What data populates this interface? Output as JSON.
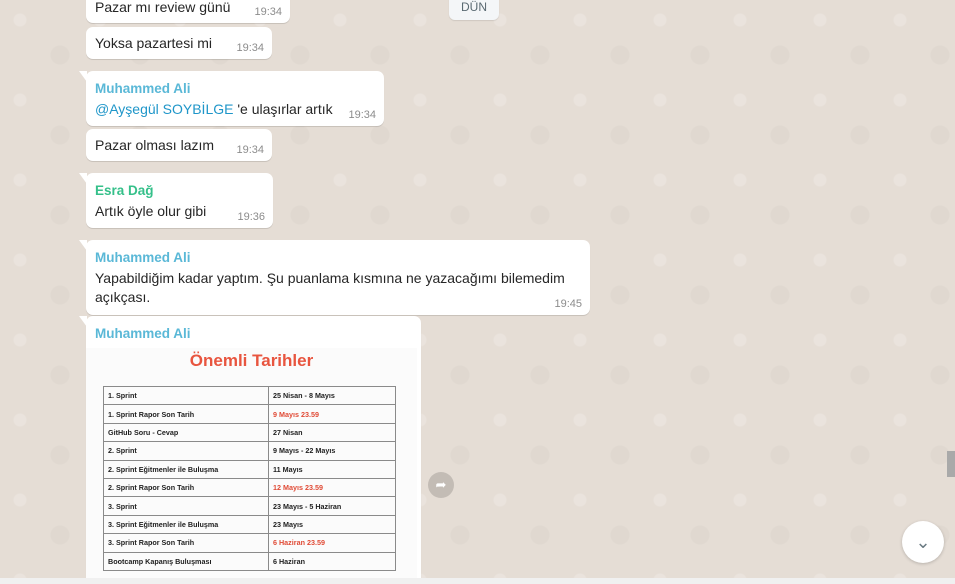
{
  "date_separator": "DÜN",
  "messages": [
    {
      "text": "Pazar mı review günü",
      "time": "19:34"
    },
    {
      "text": "Yoksa pazartesi mi",
      "time": "19:34"
    },
    {
      "sender": "Muhammed Ali",
      "mention": "@Ayşegül SOYBİLGE",
      "text": " 'e ulaşırlar artık",
      "time": "19:34"
    },
    {
      "text": "Pazar olması lazım",
      "time": "19:34"
    },
    {
      "sender": "Esra Dağ",
      "text": "Artık öyle olur gibi",
      "time": "19:36"
    },
    {
      "sender": "Muhammed Ali",
      "text": "Yapabildiğim kadar yaptım. Şu puanlama kısmına ne yazacağımı bilemedim açıkçası.",
      "time": "19:45"
    },
    {
      "sender": "Muhammed Ali"
    }
  ],
  "image": {
    "title": "Önemli Tarihler",
    "rows": [
      {
        "event": "1. Sprint",
        "date": "25 Nisan - 8 Mayıs",
        "highlight": false
      },
      {
        "event": "1. Sprint Rapor Son Tarih",
        "date": "9 Mayıs 23.59",
        "highlight": true
      },
      {
        "event": "GitHub Soru - Cevap",
        "date": "27 Nisan",
        "highlight": false
      },
      {
        "event": "2. Sprint",
        "date": "9 Mayıs - 22 Mayıs",
        "highlight": false
      },
      {
        "event": "2. Sprint Eğitmenler ile Buluşma",
        "date": "11 Mayıs",
        "highlight": false
      },
      {
        "event": "2. Sprint Rapor Son Tarih",
        "date": "12 Mayıs 23.59",
        "highlight": true
      },
      {
        "event": "3. Sprint",
        "date": "23 Mayıs - 5 Haziran",
        "highlight": false
      },
      {
        "event": "3. Sprint Eğitmenler ile Buluşma",
        "date": "23 Mayıs",
        "highlight": false
      },
      {
        "event": "3. Sprint Rapor Son Tarih",
        "date": "6 Haziran 23.59",
        "highlight": true
      },
      {
        "event": "Bootcamp Kapanış Buluşması",
        "date": "6 Haziran",
        "highlight": false
      }
    ]
  },
  "colors": {
    "sender_blue": "#5ab8d7",
    "sender_green": "#35c08a",
    "mention": "#1f96c9",
    "highlight_red": "#e04a35",
    "chat_background": "#e5ddd5"
  },
  "icons": {
    "forward": "forward-icon",
    "scroll_down": "chevron-down-icon"
  }
}
